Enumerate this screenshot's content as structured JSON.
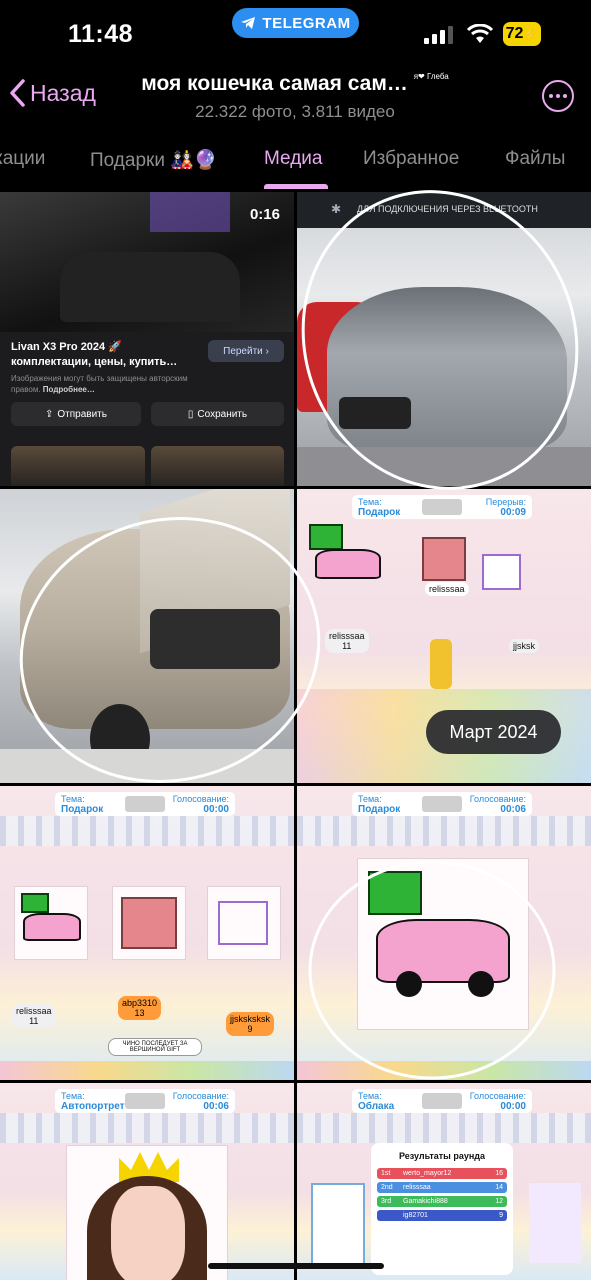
{
  "status_bar": {
    "time": "11:48",
    "pill_label": "TELEGRAM",
    "battery": "72"
  },
  "header": {
    "back_label": "Назад",
    "title": "моя кошечка самая сам…",
    "badge": "я❤ Глеба",
    "subtitle": "22.322 фото, 3.811 видео"
  },
  "tabs": [
    {
      "label": "кации"
    },
    {
      "label": "Подарки 🎎🔮"
    },
    {
      "label": "Медиа"
    },
    {
      "label": "Избранное"
    },
    {
      "label": "Файлы"
    }
  ],
  "media": {
    "ad": {
      "duration": "0:16",
      "title": "Livan X3 Pro 2024 🚀 комплектации, цены, купить…",
      "go_label": "Перейти",
      "note_a": "Изображения могут быть защищены авторским правом. ",
      "note_b": "Подробнее…",
      "send_label": "Отправить",
      "save_label": "Сохранить"
    },
    "banner": "ДЛЯ ПОДКЛЮЧЕНИЯ ЧЕРЕЗ BLUETOOTH",
    "game1": {
      "theme_label": "Тема:",
      "theme": "Подарок",
      "break_label": "Перерыв:",
      "timer": "00:09",
      "player1": "relisssaa",
      "player1_score": "11",
      "gift_name": "relisssaa",
      "box_label": "jjsksk"
    },
    "date_pill": "Март 2024",
    "game2": {
      "theme_label": "Тема:",
      "theme": "Подарок",
      "vote_label": "Голосование:",
      "timer": "00:00",
      "p1": "relisssaa",
      "p1_score": "11",
      "p2": "abp3310",
      "p2_score": "13",
      "p3": "jjsksksksk",
      "p3_score": "9",
      "sign": "ЧИНО ПОСЛЕДУЕТ ЗА ВЕРШИНОЙ GIFT"
    },
    "game3": {
      "theme_label": "Тема:",
      "theme": "Подарок",
      "vote_label": "Голосование:",
      "timer": "00:06"
    },
    "game4": {
      "theme_label": "Тема:",
      "theme": "Автопортрет",
      "vote_label": "Голосование:",
      "timer": "00:06"
    },
    "game5": {
      "theme_label": "Тема:",
      "theme": "Облака",
      "vote_label": "Голосование:",
      "timer": "00:00",
      "results_title": "Результаты раунда",
      "rows": [
        {
          "place": "1st",
          "name": "werto_mayor12",
          "score": "16",
          "color": "#e8505b"
        },
        {
          "place": "2nd",
          "name": "relisssaa",
          "score": "14",
          "color": "#4a8fe0"
        },
        {
          "place": "3rd",
          "name": "Gamakichi888",
          "score": "12",
          "color": "#3dbb5a"
        },
        {
          "place": "",
          "name": "ig82701",
          "score": "9",
          "color": "#3a58c8"
        }
      ]
    }
  },
  "colors": {
    "accent": "#e9a8f0",
    "telegram": "#2b8ef0",
    "battery": "#f5d400"
  }
}
